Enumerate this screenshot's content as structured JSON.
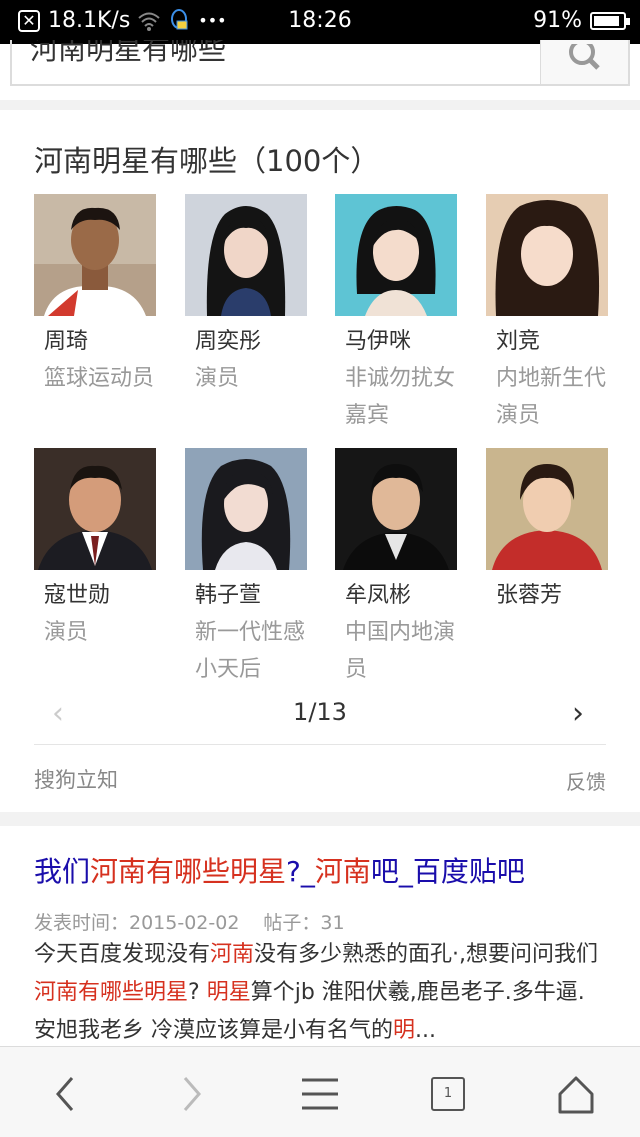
{
  "status_bar": {
    "speed": "18.1K/s",
    "more": "•••",
    "time": "18:26",
    "battery": "91%",
    "battery_level": 0.91
  },
  "search": {
    "query": "河南明星有哪些"
  },
  "knowledge_card": {
    "title": "河南明星有哪些（100个）",
    "people": [
      {
        "name": "周琦",
        "desc": "篮球运动员"
      },
      {
        "name": "周奕彤",
        "desc": "演员"
      },
      {
        "name": "马伊咪",
        "desc": "非诚勿扰女嘉宾"
      },
      {
        "name": "刘竞",
        "desc": "内地新生代演员"
      },
      {
        "name": "寇世勋",
        "desc": "演员"
      },
      {
        "name": "韩子萱",
        "desc": "新一代性感小天后"
      },
      {
        "name": "牟凤彬",
        "desc": "中国内地演员"
      },
      {
        "name": "张蓉芳",
        "desc": ""
      }
    ],
    "pager": "1/13",
    "prev": "‹",
    "next": "›",
    "source": "搜狗立知",
    "feedback": "反馈"
  },
  "result": {
    "title_parts": [
      "我们",
      "河南有哪些明星",
      "?_",
      "河南",
      "吧_百度贴吧"
    ],
    "date": "发表时间：2015-02-02",
    "posts": "帖子：31",
    "body_parts": [
      "今天百度发现没有",
      "河南",
      "没有多少熟悉的面孔·,想要问问我们",
      "河南有哪些明星",
      "? ",
      "明星",
      "算个jb 淮阳伏羲,鹿邑老子.多牛逼. 安旭我老乡 冷漠应该算是小有名气的",
      "明",
      "..."
    ]
  },
  "bottom_nav": {
    "tab_count": "1"
  },
  "colors": {
    "link": "#1a0dab",
    "highlight": "#d6311f"
  }
}
